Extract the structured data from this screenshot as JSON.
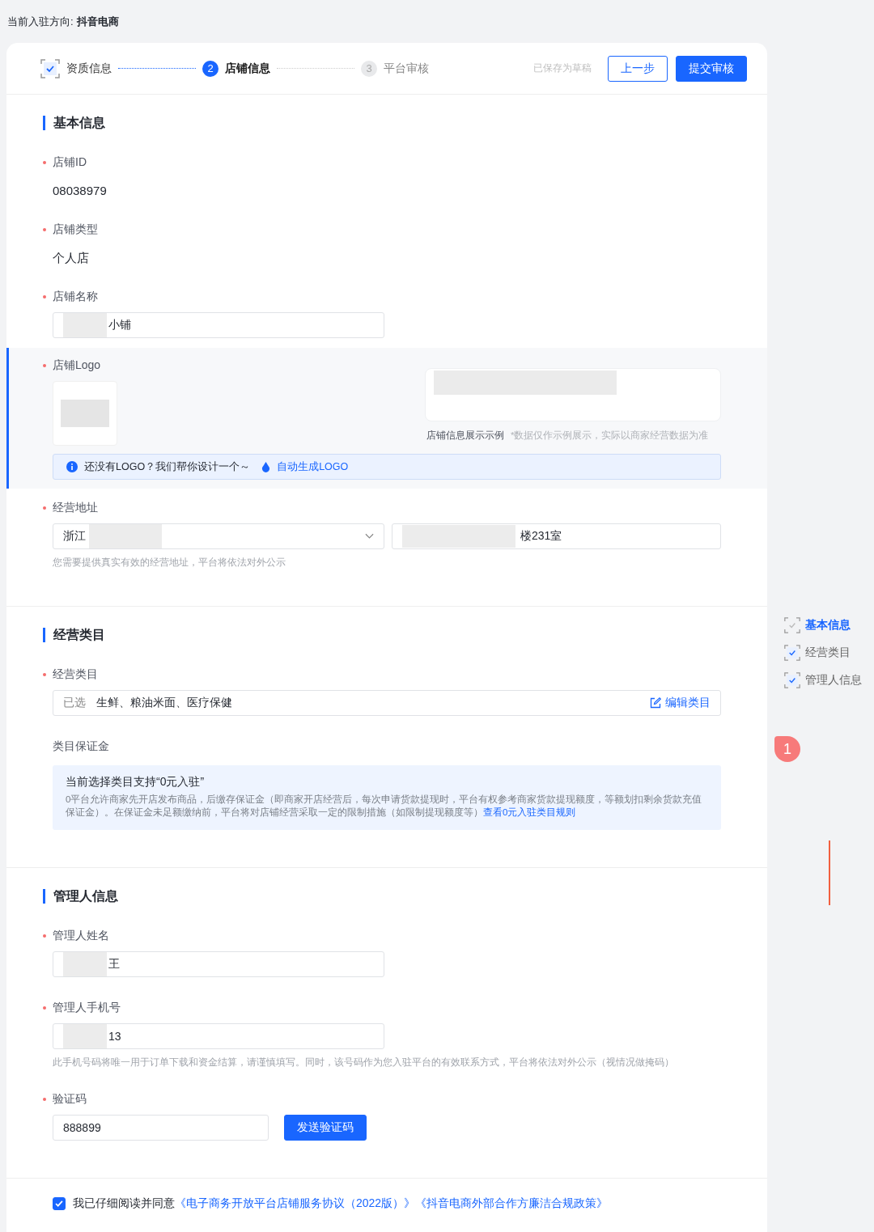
{
  "header": {
    "label": "当前入驻方向:",
    "value": "抖音电商"
  },
  "stepper": [
    {
      "label": "资质信息",
      "completed": true,
      "selected": false
    },
    {
      "number": "2",
      "label": "店铺信息",
      "completed": false,
      "selected": true
    },
    {
      "number": "3",
      "label": "平台审核",
      "completed": false,
      "selected": false
    }
  ],
  "draft_status": "已保存为草稿",
  "buttons": [
    {
      "label": "上一步",
      "kind": "secondary"
    },
    {
      "label": "提交审核",
      "kind": "primary"
    }
  ],
  "sections": [
    {
      "title": "基本信息",
      "fields": [
        {
          "kind": "static",
          "label": "店铺ID",
          "required": true,
          "value": "08038979"
        },
        {
          "kind": "static",
          "label": "店铺类型",
          "required": true,
          "value": "个人店"
        },
        {
          "kind": "input",
          "label": "店铺名称",
          "required": true,
          "value": "小铺",
          "redacted": true
        },
        {
          "kind": "logo",
          "label": "店铺Logo",
          "required": true,
          "highlighted": true,
          "preview_caption": "店铺信息展示示例",
          "preview_note": "*数据仅作示例展示，实际以商家经营数据为准",
          "tip": "还没有LOGO？我们帮你设计一个～",
          "tip_link": "自动生成LOGO"
        },
        {
          "kind": "address",
          "label": "经营地址",
          "required": true,
          "select_value": "浙江",
          "detail_value": "楼231室",
          "redacted": true,
          "hint": "您需要提供真实有效的经营地址，平台将依法对外公示"
        }
      ]
    },
    {
      "title": "经营类目",
      "fields": [
        {
          "kind": "category",
          "label": "经营类目",
          "required": true,
          "prefix": "已选",
          "value": "生鲜、粮油米面、医疗保健",
          "action": "编辑类目"
        },
        {
          "kind": "notice",
          "label": "类目保证金",
          "required": false,
          "title": "当前选择类目支持“0元入驻”",
          "body": "0平台允许商家先开店发布商品，后缴存保证金（即商家开店经营后，每次申请货款提现时，平台有权参考商家货款提现额度，等额划扣剩余货款充值保证金）。在保证金未足额缴纳前，平台将对店铺经营采取一定的限制措施（如限制提现额度等）",
          "link": "查看0元入驻类目规则"
        }
      ]
    },
    {
      "title": "管理人信息",
      "fields": [
        {
          "kind": "input",
          "label": "管理人姓名",
          "required": true,
          "value": "王",
          "redacted": true
        },
        {
          "kind": "input",
          "label": "管理人手机号",
          "required": true,
          "value": "13",
          "redacted": true,
          "hint": "此手机号码将唯一用于订单下载和资金结算，请谨慎填写。同时，该号码作为您入驻平台的有效联系方式，平台将依法对外公示（视情况做掩码）"
        },
        {
          "kind": "code",
          "label": "验证码",
          "required": true,
          "value": "888899",
          "button": "发送验证码"
        }
      ]
    }
  ],
  "agreement": {
    "checked": true,
    "text": "我已仔细阅读并同意",
    "links": [
      "《电子商务开放平台店铺服务协议（2022版）》",
      "《抖音电商外部合作方廉洁合规政策》"
    ]
  },
  "side_nav": [
    {
      "label": "基本信息",
      "done": false,
      "selected": true
    },
    {
      "label": "经营类目",
      "done": true,
      "selected": false
    },
    {
      "label": "管理人信息",
      "done": true,
      "selected": false
    }
  ],
  "annotation": {
    "badge": "1"
  }
}
